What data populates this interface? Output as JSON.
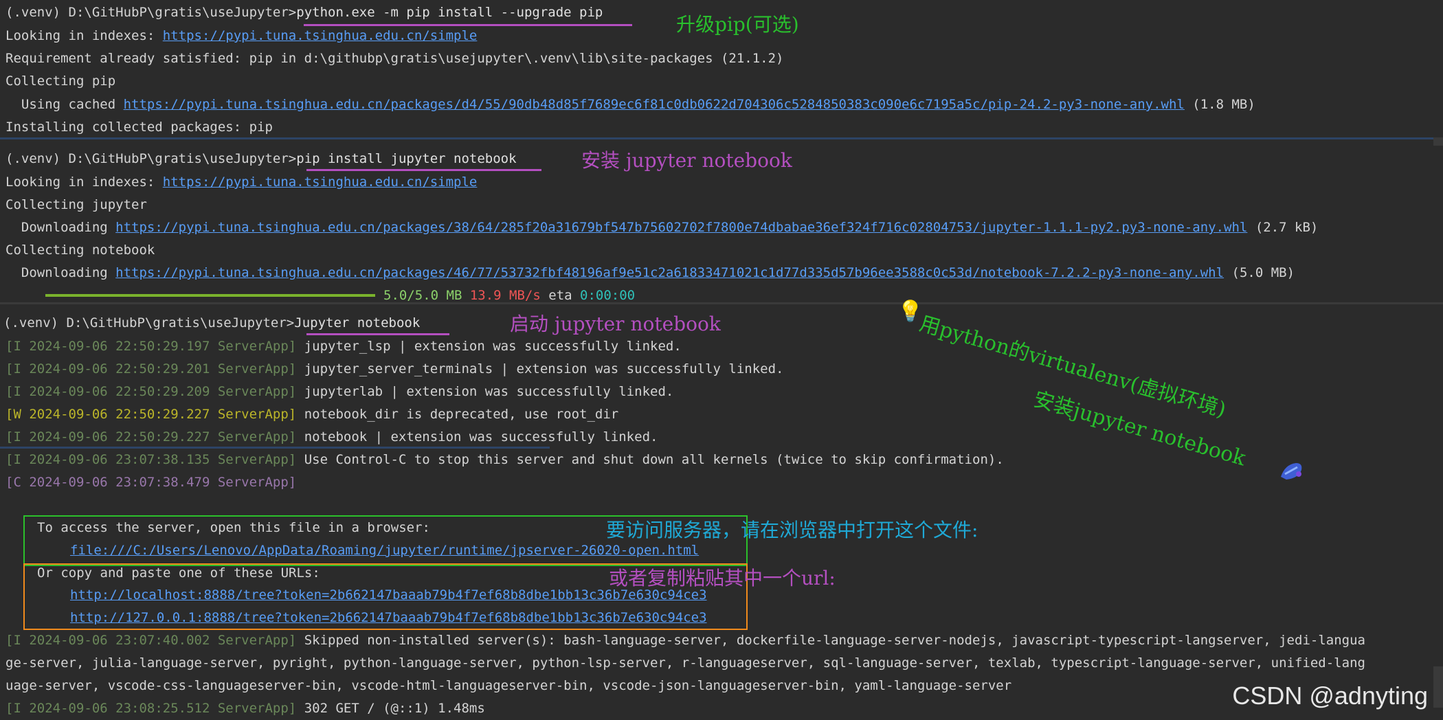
{
  "block1": {
    "prompt": "(.venv) D:\\GitHubP\\gratis\\useJupyter>",
    "command": "python.exe -m pip install --upgrade pip",
    "annotation": "升级pip(可选)",
    "indexes_label": "Looking in indexes: ",
    "indexes_url": "https://pypi.tuna.tsinghua.edu.cn/simple",
    "requirement": "Requirement already satisfied: pip in d:\\githubp\\gratis\\usejupyter\\.venv\\lib\\site-packages (21.1.2)",
    "collecting": "Collecting pip",
    "cached_label": "  Using cached ",
    "cached_url": "https://pypi.tuna.tsinghua.edu.cn/packages/d4/55/90db48d85f7689ec6f81c0db0622d704306c5284850383c090e6c7195a5c/pip-24.2-py3-none-any.whl",
    "cached_size": " (1.8 MB)",
    "installing": "Installing collected packages: pip"
  },
  "block2": {
    "prompt": "(.venv) D:\\GitHubP\\gratis\\useJupyter>",
    "command": "pip install jupyter notebook",
    "annotation": "安装 jupyter notebook",
    "indexes_label": "Looking in indexes: ",
    "indexes_url": "https://pypi.tuna.tsinghua.edu.cn/simple",
    "collecting_jupyter": "Collecting jupyter",
    "download1_label": "  Downloading ",
    "download1_url": "https://pypi.tuna.tsinghua.edu.cn/packages/38/64/285f20a31679bf547b75602702f7800e74dbabae36ef324f716c02804753/jupyter-1.1.1-py2.py3-none-any.whl",
    "download1_size": " (2.7 kB)",
    "collecting_notebook": "Collecting notebook",
    "download2_label": "  Downloading ",
    "download2_url": "https://pypi.tuna.tsinghua.edu.cn/packages/46/77/53732fbf48196af9e51c2a61833471021c1d77d335d57b96ee3588c0c53d/notebook-7.2.2-py3-none-any.whl",
    "download2_size": " (5.0 MB)",
    "progress": {
      "fraction": 1.0,
      "size": "5.0/5.0 MB",
      "speed": "13.9 MB/s",
      "eta_label": "eta",
      "eta": "0:00:00"
    }
  },
  "block3": {
    "prompt": "(.venv) D:\\GitHubP\\gratis\\useJupyter>",
    "command": "Jupyter notebook",
    "annotation": "启动 jupyter notebook",
    "logs": [
      {
        "tag": "[I 2024-09-06 22:50:29.197 ServerApp]",
        "msg": " jupyter_lsp | extension was successfully linked."
      },
      {
        "tag": "[I 2024-09-06 22:50:29.201 ServerApp]",
        "msg": " jupyter_server_terminals | extension was successfully linked."
      },
      {
        "tag": "[I 2024-09-06 22:50:29.209 ServerApp]",
        "msg": " jupyterlab | extension was successfully linked."
      },
      {
        "tag": "[W 2024-09-06 22:50:29.227 ServerApp]",
        "msg": " notebook_dir is deprecated, use root_dir"
      },
      {
        "tag": "[I 2024-09-06 22:50:29.227 ServerApp]",
        "msg": " notebook | extension was successfully linked."
      }
    ],
    "log_ctrl": {
      "tag": "[I 2024-09-06 23:07:38.135 ServerApp]",
      "msg": " Use Control-C to stop this server and shut down all kernels (twice to skip confirmation)."
    },
    "log_c": {
      "tag": "[C 2024-09-06 23:07:38.479 ServerApp]"
    },
    "access_text": "To access the server, open this file in a browser:",
    "access_url": "file:///C:/Users/Lenovo/AppData/Roaming/jupyter/runtime/jpserver-26020-open.html",
    "access_annotation": "要访问服务器，请在浏览器中打开这个文件:",
    "copy_text": "Or copy and paste one of these URLs:",
    "url_localhost": "http://localhost:8888/tree?token=2b662147baaab79b4f7ef68b8dbe1bb13c36b7e630c94ce3",
    "url_127": "http://127.0.0.1:8888/tree?token=2b662147baaab79b4f7ef68b8dbe1bb13c36b7e630c94ce3",
    "copy_annotation": "或者复制粘贴其中一个url:",
    "skipped_tag": "[I 2024-09-06 23:07:40.002 ServerApp]",
    "skipped_line1": " Skipped non-installed server(s): bash-language-server, dockerfile-language-server-nodejs, javascript-typescript-langserver, jedi-langua",
    "skipped_line2": "ge-server, julia-language-server, pyright, python-language-server, python-lsp-server, r-languageserver, sql-language-server, texlab, typescript-language-server, unified-lang",
    "skipped_line3": "uage-server, vscode-css-languageserver-bin, vscode-html-languageserver-bin, vscode-json-languageserver-bin, yaml-language-server",
    "get_tag": "[I 2024-09-06 23:08:25.512 ServerApp]",
    "get_msg": " 302 GET / (@::1) 1.48ms"
  },
  "side_note": {
    "line1": "用python的virtualenv(虚拟环境)",
    "line2": "安装jupyter notebook",
    "bulb_icon": "lightbulb-icon",
    "brush_icon": "brush-icon"
  },
  "watermark": "CSDN @adnyting",
  "colors": {
    "accent_purple": "#b44fc0",
    "accent_green": "#29c02d",
    "accent_cyan": "#1fa9d6",
    "link": "#589df6",
    "box_green": "#2bc02b",
    "box_orange": "#f08a1c"
  }
}
